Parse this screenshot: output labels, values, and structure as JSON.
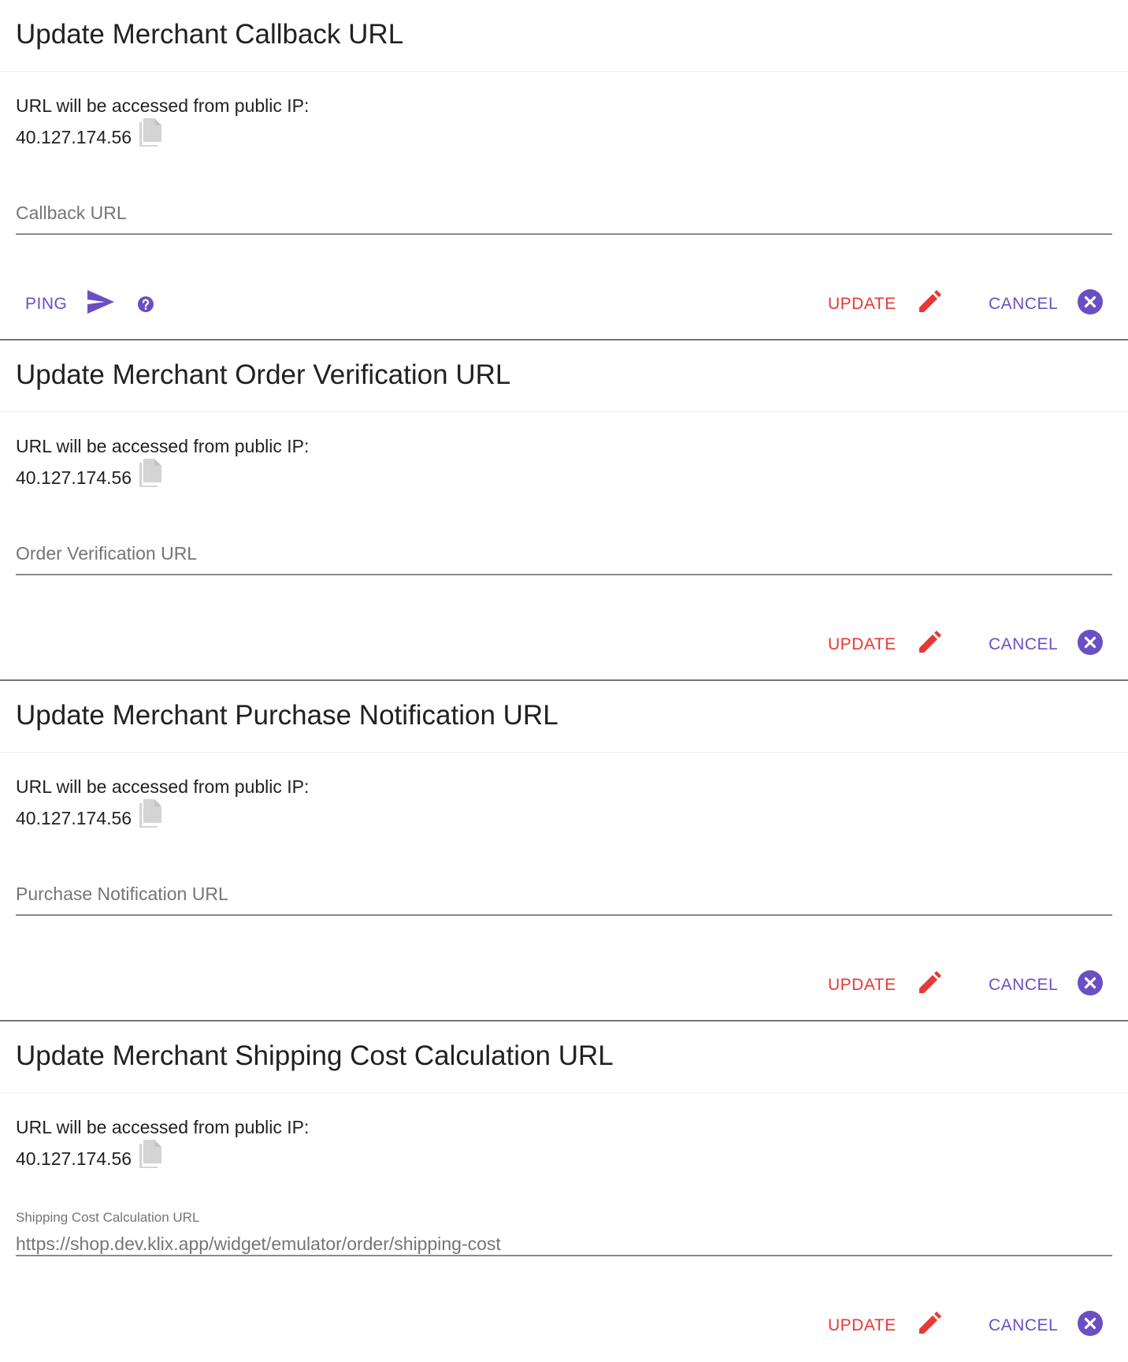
{
  "colors": {
    "primary": "#6a4fc4",
    "danger": "#e53935",
    "text": "#212121",
    "muted": "#757575"
  },
  "icons": {
    "copy": "copy-icon",
    "send": "send-icon",
    "help": "help-circle-icon",
    "edit": "pencil-icon",
    "cancel": "close-circle-icon"
  },
  "cards": [
    {
      "title": "Update Merchant Callback URL",
      "ip_label": "URL will be accessed from public IP:",
      "ip_value": "40.127.174.56",
      "field_placeholder": "Callback URL",
      "ping_label": "PING",
      "update_label": "UPDATE",
      "cancel_label": "CANCEL"
    },
    {
      "title": "Update Merchant Order Verification URL",
      "ip_label": "URL will be accessed from public IP:",
      "ip_value": "40.127.174.56",
      "field_placeholder": "Order Verification URL",
      "update_label": "UPDATE",
      "cancel_label": "CANCEL"
    },
    {
      "title": "Update Merchant Purchase Notification URL",
      "ip_label": "URL will be accessed from public IP:",
      "ip_value": "40.127.174.56",
      "field_placeholder": "Purchase Notification URL",
      "update_label": "UPDATE",
      "cancel_label": "CANCEL"
    },
    {
      "title": "Update Merchant Shipping Cost Calculation URL",
      "ip_label": "URL will be accessed from public IP:",
      "ip_value": "40.127.174.56",
      "field_label": "Shipping Cost Calculation URL",
      "field_value": "https://shop.dev.klix.app/widget/emulator/order/shipping-cost",
      "update_label": "UPDATE",
      "cancel_label": "CANCEL"
    }
  ]
}
